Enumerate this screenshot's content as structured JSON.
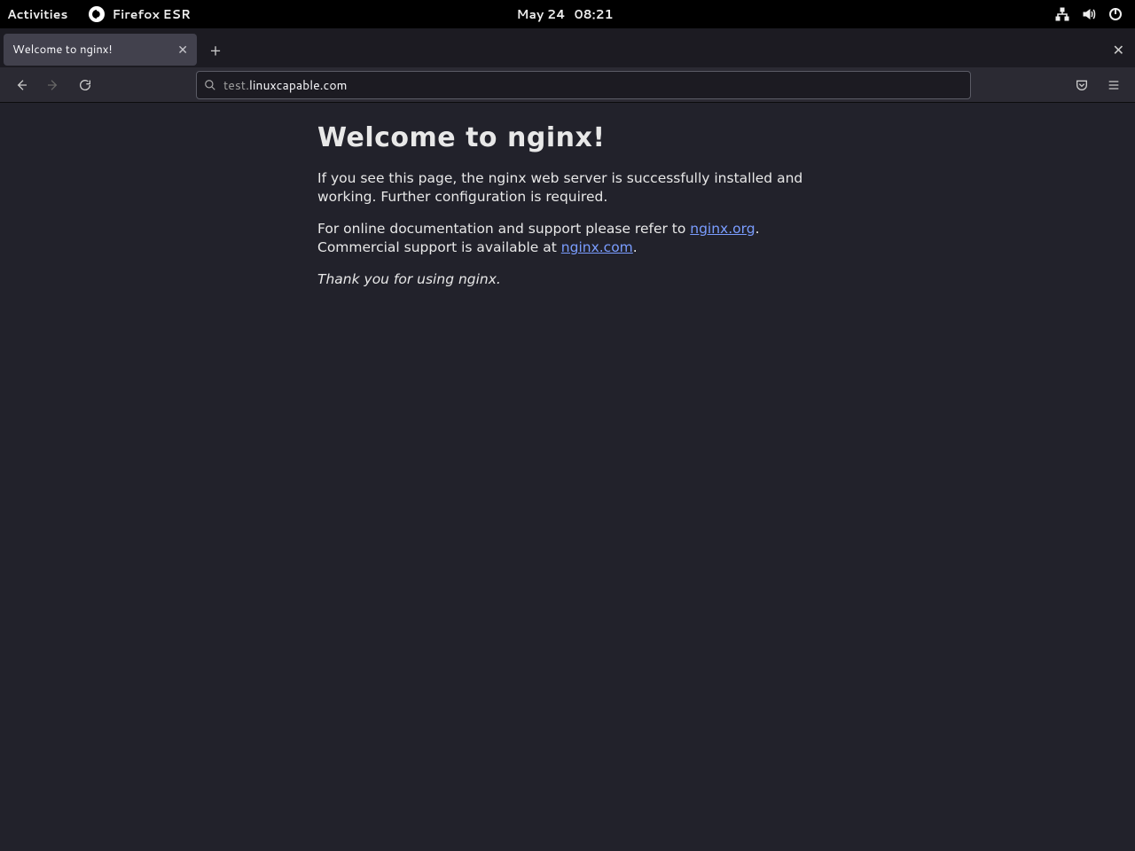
{
  "gnome": {
    "activities": "Activities",
    "app_name": "Firefox ESR",
    "date": "May 24",
    "time": "08:21"
  },
  "browser": {
    "tab_title": "Welcome to nginx!",
    "url_prefix": "test.",
    "url_main": "linuxcapable.com"
  },
  "page": {
    "heading": "Welcome to nginx!",
    "p1": "If you see this page, the nginx web server is successfully installed and working. Further configuration is required.",
    "p2_a": "For online documentation and support please refer to ",
    "p2_link1": "nginx.org",
    "p2_b": ".",
    "p3_a": "Commercial support is available at ",
    "p3_link2": "nginx.com",
    "p3_b": ".",
    "p4": "Thank you for using nginx."
  }
}
